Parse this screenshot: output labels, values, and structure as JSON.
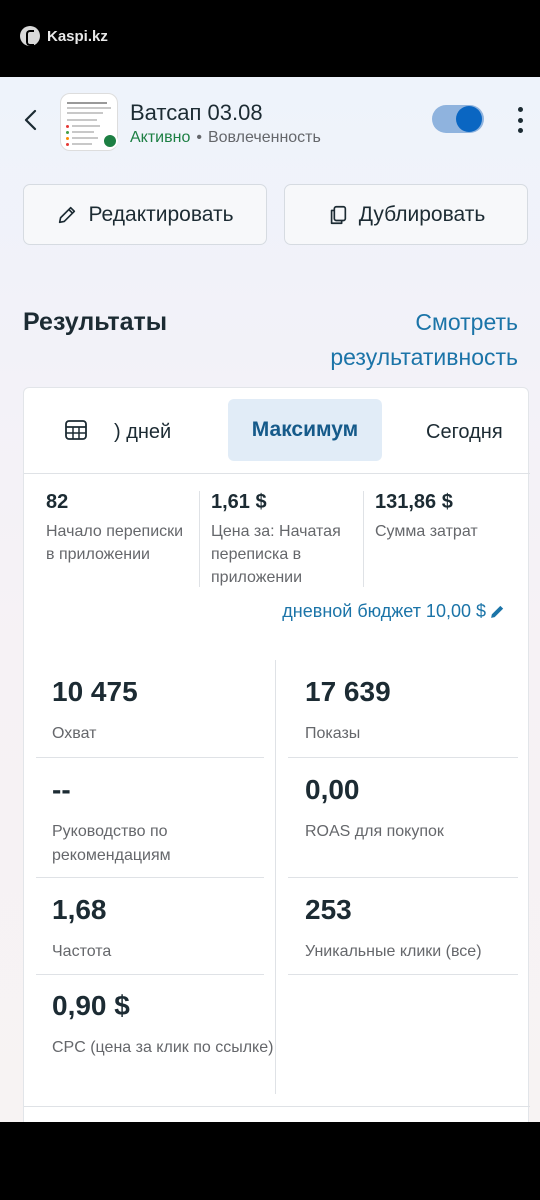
{
  "statusbar": {
    "app": "Kaspi.kz"
  },
  "header": {
    "title": "Ватсап 03.08",
    "status": "Активно",
    "separator": "•",
    "engagement": "Вовлеченность",
    "toggle_on": true
  },
  "actions": {
    "edit": "Редактировать",
    "duplicate": "Дублировать"
  },
  "results": {
    "title": "Результаты",
    "link": "Смотреть результативность"
  },
  "tabs": {
    "days": ") дней",
    "maximum": "Максимум",
    "today": "Сегодня"
  },
  "summary": [
    {
      "value": "82",
      "label": "Начало переписки в приложении"
    },
    {
      "value": "1,61 $",
      "label": "Цена за: Начатая переписка в приложении"
    },
    {
      "value": "131,86 $",
      "label": "Сумма затрат"
    }
  ],
  "budget": "дневной бюджет 10,00 $",
  "metrics": {
    "reach": {
      "value": "10 475",
      "label": "Охват"
    },
    "impressions": {
      "value": "17 639",
      "label": "Показы"
    },
    "guidance": {
      "value": "--",
      "label": "Руководство по рекомендациям"
    },
    "roas": {
      "value": "0,00",
      "label": "ROAS для покупок"
    },
    "frequency": {
      "value": "1,68",
      "label": "Частота"
    },
    "unique_clicks": {
      "value": "253",
      "label": "Уникальные клики (все)"
    },
    "cpc": {
      "value": "0,90 $",
      "label": "CPC (цена за клик по ссылке)"
    }
  },
  "colors": {
    "accent": "#0a66c2",
    "link": "#1b74a8",
    "active": "#1d7f43"
  }
}
